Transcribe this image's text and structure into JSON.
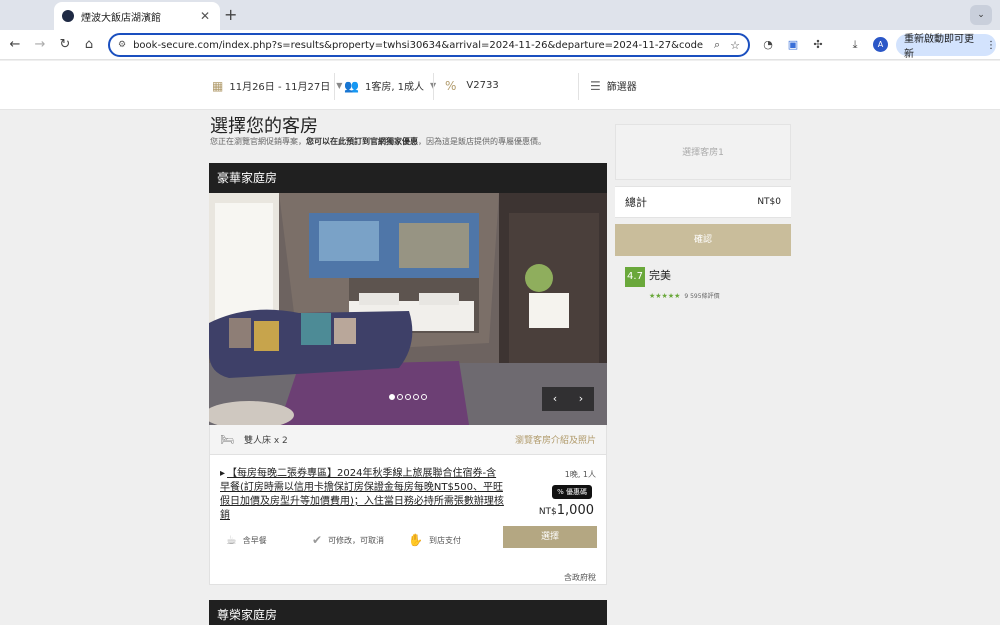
{
  "browser": {
    "tab_title": "煙波大飯店湖濱館",
    "url": "book-secure.com/index.php?s=results&property=twhsi30634&arrival=2024-11-26&departure=2024-11-27&code=V273...",
    "avatar_letter": "A",
    "update_label": "重新啟動即可更新"
  },
  "filters": {
    "dates": "11月26日 - 11月27日",
    "guests": "1客房, 1成人",
    "promo_code": "V2733",
    "filter_label": "篩選器"
  },
  "page": {
    "title": "選擇您的客房",
    "subtitle_pre": "您正在瀏覽官網促銷專案，",
    "subtitle_bold": "您可以在此預訂到官網獨家優惠",
    "subtitle_post": "，因為這是飯店提供的專屬優惠價。"
  },
  "room1": {
    "name": "豪華家庭房",
    "bed": "雙人床 x 2",
    "photos_link": "瀏覽客房介紹及照片",
    "slides": {
      "total": 5,
      "active": 1
    },
    "rate": {
      "name": "【每房每晚二張券專區】2024年秋季線上旅展聯合住宿券-含早餐(訂房時需以信用卡擔保訂房保證金每房每晚NT$500、平旺假日加價及房型升等加價費用)；入住當日務必持所需張數辦理核銷",
      "occupancy": "1晚, 1人",
      "badge": "% 優惠碼",
      "currency": "NT$",
      "amount": "1,000",
      "select": "選擇",
      "tax_note": "含政府稅",
      "features": [
        "含早餐",
        "可修改，可取消",
        "到店支付"
      ]
    }
  },
  "room2": {
    "name": "尊榮家庭房"
  },
  "summary": {
    "select_room": "選擇客房1",
    "total_label": "總計",
    "total_amount": "NT$0",
    "confirm": "確認"
  },
  "rating": {
    "score": "4.7",
    "label": "完美",
    "stars_fraction": 0.94,
    "count": "9 595條評價"
  },
  "colors": {
    "gold": "#b4a782",
    "dark_header": "#202020",
    "rating_green": "#6aa83b"
  }
}
